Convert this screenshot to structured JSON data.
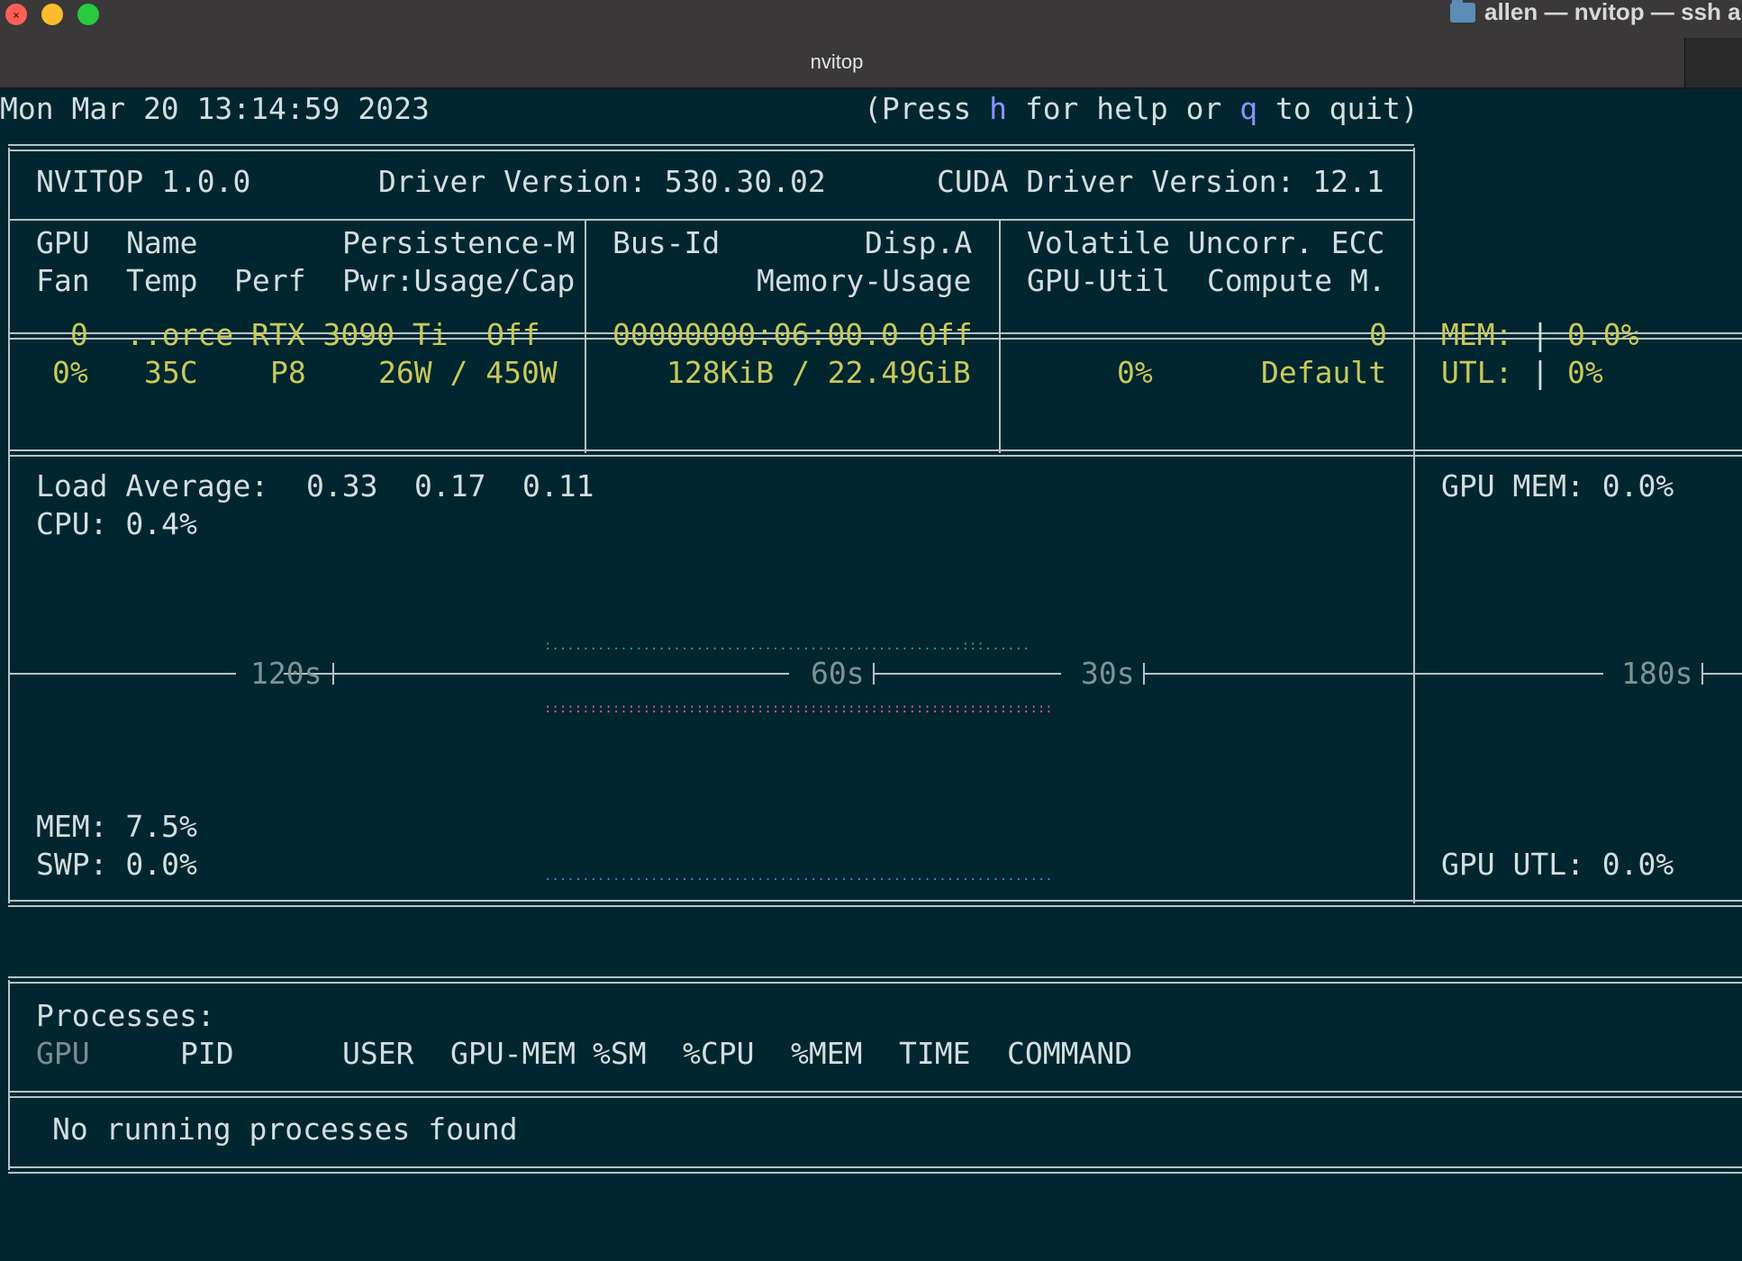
{
  "window": {
    "title": "nvitop",
    "tab_title": "allen — nvitop — ssh a"
  },
  "header": {
    "datetime": "Mon Mar 20 13:14:59 2023",
    "help_prefix": "(Press ",
    "help_key": "h",
    "help_mid": " for help or ",
    "quit_key": "q",
    "help_suffix": " to quit)"
  },
  "summary": {
    "version": "NVITOP 1.0.0",
    "driver": "Driver Version: 530.30.02",
    "cuda": "CUDA Driver Version: 12.1"
  },
  "gpu_table": {
    "h1": {
      "gpu": "GPU",
      "name": "Name",
      "persistence": "Persistence-M",
      "bus": "Bus-Id",
      "disp": "Disp.A",
      "ecc": "Volatile Uncorr. ECC"
    },
    "h2": {
      "fan": "Fan",
      "temp": "Temp",
      "perf": "Perf",
      "pwr": "Pwr:Usage/Cap",
      "mem": "Memory-Usage",
      "util": "GPU-Util",
      "compute": "Compute M."
    },
    "gpus": [
      {
        "index": "0",
        "name": "..orce RTX 3090 Ti",
        "persistence": "Off",
        "bus_id": "00000000:06:00.0",
        "disp": "Off",
        "ecc": "0",
        "fan": "0%",
        "temp": "35C",
        "perf": "P8",
        "power": "26W / 450W",
        "memory": "128KiB / 22.49GiB",
        "util": "0%",
        "compute": "Default",
        "side_mem_label": "MEM:",
        "side_mem": "0.0%",
        "side_utl_label": "UTL:",
        "side_utl": "0%"
      }
    ]
  },
  "host": {
    "load_label": "Load Average:",
    "load": [
      "0.33",
      "0.17",
      "0.11"
    ],
    "cpu": "CPU: 0.4%",
    "mem": "MEM: 7.5%",
    "swp": "SWP: 0.0%",
    "gpu_mem": "GPU MEM: 0.0%",
    "gpu_utl": "GPU UTL: 0.0%",
    "time_ticks": [
      "120s",
      "60s",
      "30s",
      "180s"
    ]
  },
  "processes": {
    "title": "Processes:",
    "columns": [
      "GPU",
      "PID",
      "USER",
      "GPU-MEM",
      "%SM",
      "%CPU",
      "%MEM",
      "TIME",
      "COMMAND"
    ],
    "empty": "No running processes found"
  },
  "colors": {
    "background": "#02262f",
    "text": "#d3dee0",
    "gpu_values": "#c7c95c",
    "keys": "#8a92ff",
    "cpu_graph": "#2ea39a",
    "gpu_mem_graph": "#e45aa8",
    "mem_graph": "#3a8fe0"
  }
}
